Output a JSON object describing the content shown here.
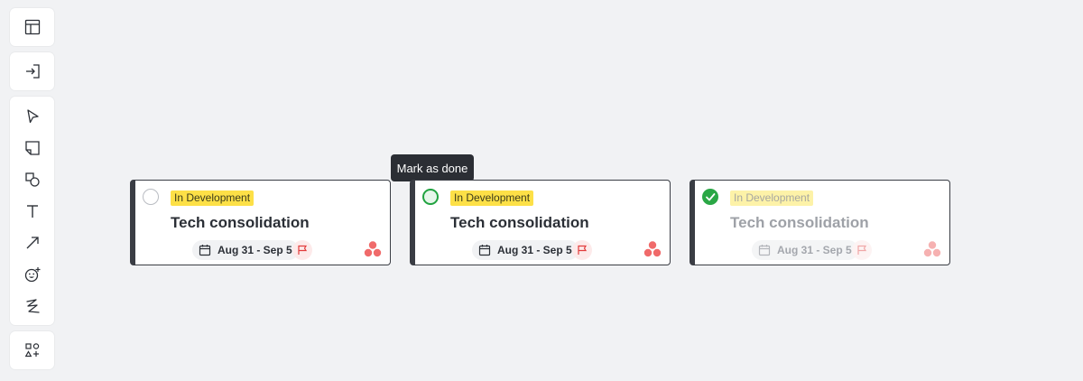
{
  "toolbar": {
    "top": [
      {
        "name": "layout-panel-icon"
      },
      {
        "name": "import-icon"
      }
    ],
    "tools": [
      {
        "name": "select-pointer-icon"
      },
      {
        "name": "sticky-note-icon"
      },
      {
        "name": "shapes-icon"
      },
      {
        "name": "text-icon"
      },
      {
        "name": "arrow-line-icon"
      },
      {
        "name": "emoji-add-icon"
      },
      {
        "name": "pen-draw-icon"
      }
    ],
    "bottom": [
      {
        "name": "more-shapes-add-icon"
      }
    ]
  },
  "tooltip": {
    "text": "Mark as done"
  },
  "cards": [
    {
      "status": "In Development",
      "title": "Tech consolidation",
      "date": "Aug 31 - Sep 5",
      "state": "unchecked"
    },
    {
      "status": "In Development",
      "title": "Tech consolidation",
      "date": "Aug 31 - Sep 5",
      "state": "hover"
    },
    {
      "status": "In Development",
      "title": "Tech consolidation",
      "date": "Aug 31 - Sep 5",
      "state": "done"
    }
  ],
  "colors": {
    "badge": "#fde047",
    "check_done": "#2aa745",
    "card_border": "#3a3d44",
    "asana_red": "#f06a6a"
  }
}
